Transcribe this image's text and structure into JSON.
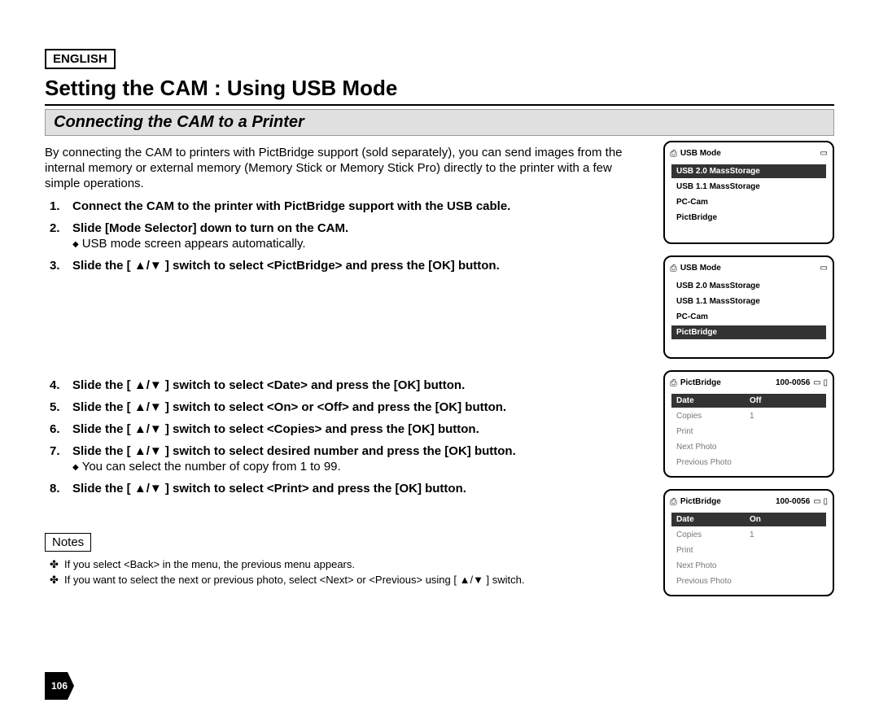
{
  "lang": "ENGLISH",
  "title": "Setting the CAM : Using USB Mode",
  "subtitle": "Connecting the CAM to a Printer",
  "intro": "By connecting the CAM to printers with PictBridge support (sold separately), you can send images from the internal memory or external memory (Memory Stick or Memory Stick Pro) directly to the printer with a few simple operations.",
  "steps": {
    "1": "Connect the CAM to the printer with PictBridge support with the USB cable.",
    "2": "Slide [Mode Selector] down to turn on the CAM.",
    "2_sub": "USB mode screen appears automatically.",
    "3": "Slide the [ ▲/▼ ] switch to select <PictBridge> and press the [OK] button.",
    "4": "Slide the [ ▲/▼ ] switch to select <Date> and press the [OK] button.",
    "5": "Slide the [ ▲/▼ ] switch to select <On> or <Off> and press the [OK] button.",
    "6": "Slide the [ ▲/▼ ] switch to select <Copies> and press the [OK] button.",
    "7": "Slide the [ ▲/▼ ] switch to select desired number and press the [OK] button.",
    "7_sub": "You can select the number of copy from 1 to 99.",
    "8": "Slide the [ ▲/▼ ] switch to select <Print> and press the [OK] button."
  },
  "notes_label": "Notes",
  "notes": {
    "0": "If you select <Back> in the menu, the previous menu appears.",
    "1": "If you want to select the next or previous photo, select <Next> or <Previous> using [ ▲/▼ ] switch."
  },
  "page_number": "106",
  "screens": {
    "s2": {
      "step": "2",
      "title": "USB Mode",
      "items": {
        "0": "USB 2.0 MassStorage",
        "1": "USB 1.1 MassStorage",
        "2": "PC-Cam",
        "3": "PictBridge"
      }
    },
    "s3": {
      "step": "3",
      "title": "USB Mode",
      "items": {
        "0": "USB 2.0 MassStorage",
        "1": "USB 1.1 MassStorage",
        "2": "PC-Cam",
        "3": "PictBridge"
      }
    },
    "s4": {
      "step": "4",
      "title": "PictBridge",
      "file": "100-0056",
      "rows": {
        "date": {
          "k": "Date",
          "v": "Off"
        },
        "copies": {
          "k": "Copies",
          "v": "1"
        },
        "print": {
          "k": "Print",
          "v": ""
        },
        "next": {
          "k": "Next Photo",
          "v": ""
        },
        "prev": {
          "k": "Previous Photo",
          "v": ""
        }
      }
    },
    "s5": {
      "step": "5",
      "title": "PictBridge",
      "file": "100-0056",
      "rows": {
        "date": {
          "k": "Date",
          "v": "On"
        },
        "copies": {
          "k": "Copies",
          "v": "1"
        },
        "print": {
          "k": "Print",
          "v": ""
        },
        "next": {
          "k": "Next Photo",
          "v": ""
        },
        "prev": {
          "k": "Previous Photo",
          "v": ""
        }
      }
    }
  }
}
